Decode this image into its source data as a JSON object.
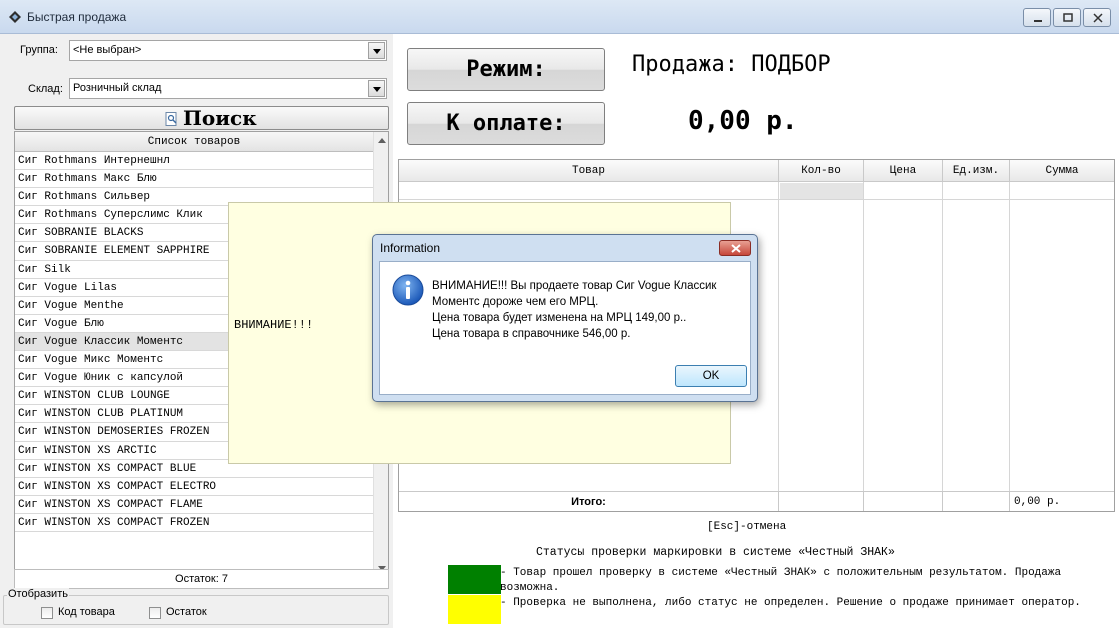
{
  "window": {
    "title": "Быстрая продажа"
  },
  "filters": {
    "group_label": "Группа:",
    "group_value": "<Не выбран>",
    "warehouse_label": "Склад:",
    "warehouse_value": "Розничный склад"
  },
  "search": {
    "label": "Поиск"
  },
  "product_list": {
    "header": "Список товаров",
    "items": [
      "Сиг Rothmans Интернешнл",
      "Сиг Rothmans Макс Блю",
      "Сиг Rothmans Сильвер",
      "Сиг Rothmans Суперслимс Клик",
      "Сиг SOBRANIE BLACKS",
      "Сиг SOBRANIE ELEMENT SAPPHIRE",
      "Сиг Silk",
      "Сиг Vogue Lilas",
      "Сиг Vogue Menthe",
      "Сиг Vogue Блю",
      "Сиг Vogue Классик Моментс",
      "Сиг Vogue Микс Моментс",
      "Сиг Vogue Юник с капсулой",
      "Сиг WINSTON CLUB LOUNGE",
      "Сиг WINSTON CLUB PLATINUM",
      "Сиг WINSTON DEMOSERIES FROZEN",
      "Сиг WINSTON XS ARCTIC",
      "Сиг WINSTON XS COMPACT BLUE",
      "Сиг WINSTON XS COMPACT ELECTRO",
      "Сиг WINSTON XS COMPACT FLAME",
      "Сиг WINSTON XS COMPACT FROZEN"
    ],
    "selected_index": 10
  },
  "ostatok": "Остаток: 7",
  "display": {
    "title": "Отобразить",
    "checkbox_code": "Код товара",
    "checkbox_ostatok": "Остаток"
  },
  "main": {
    "mode_button": "Режим:",
    "mode_text": "Продажа: ПОДБОР",
    "pay_button": "К оплате:",
    "amount": "0,00 р."
  },
  "grid": {
    "columns": [
      "Товар",
      "Кол-во",
      "Цена",
      "Ед.изм.",
      "Сумма"
    ],
    "total_label": "Итого:",
    "total_value": "0,00 р."
  },
  "hints": {
    "esc": "[Esc]-отмена",
    "status_title": "Статусы проверки маркировки в системе «Честный ЗНАК»",
    "green_text": "   -   Товар прошел проверку в системе «Честный ЗНАК» с положительным результатом. Продажа возможна.",
    "yellow_text": "   -   Проверка не выполнена, либо статус не определен. Решение о продаже принимает оператор.",
    "green_color": "#008000",
    "yellow_color": "#ffff00"
  },
  "warning": {
    "text": "ВНИМАНИЕ!!!"
  },
  "dialog": {
    "title": "Information",
    "lines": [
      "ВНИМАНИЕ!!! Вы продаете товар Сиг Vogue Классик",
      "Моментс дороже чем его МРЦ.",
      "Цена товара будет изменена на МРЦ 149,00 р..",
      "Цена товара в справочнике 546,00 р."
    ],
    "ok": "OK"
  }
}
